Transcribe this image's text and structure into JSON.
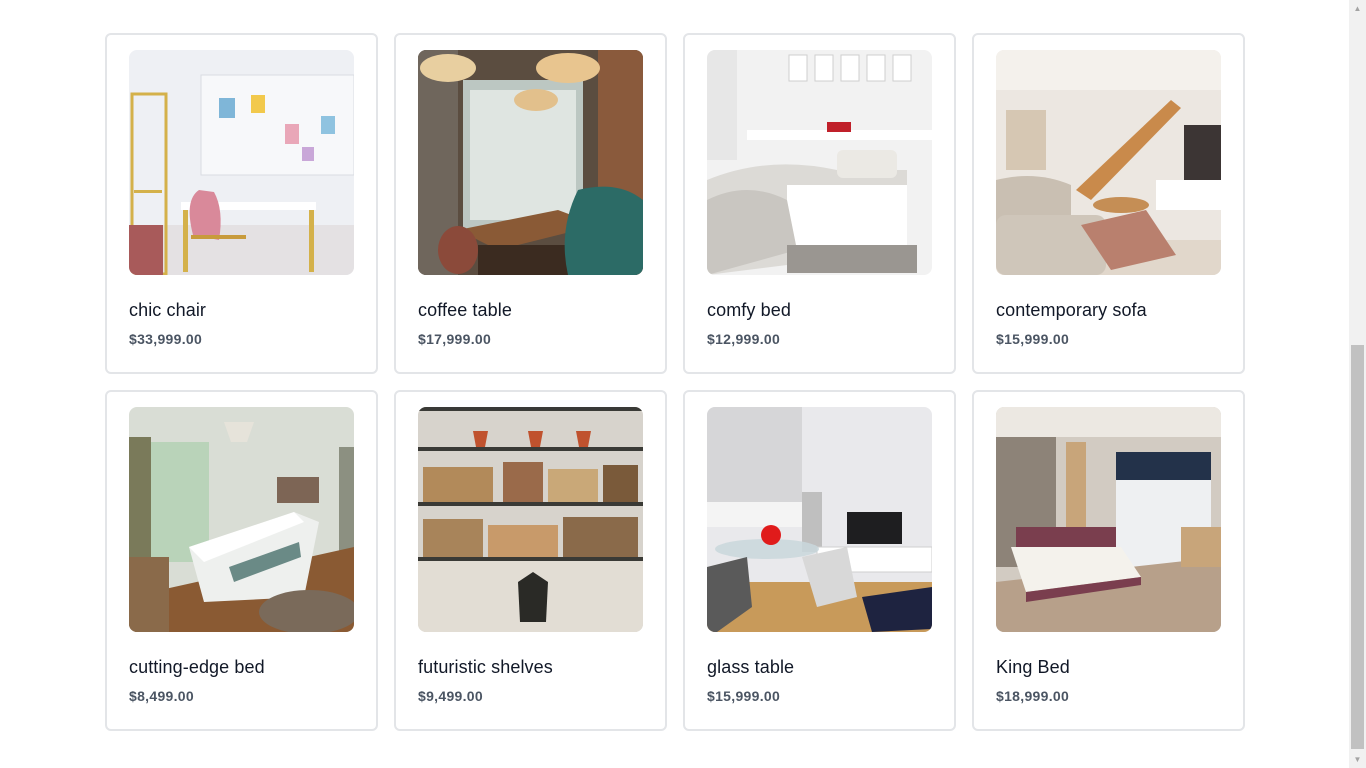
{
  "products": [
    {
      "name": "chic chair",
      "price": "$33,999.00",
      "image": "white-desk-room-photo"
    },
    {
      "name": "coffee table",
      "price": "$17,999.00",
      "image": "cafe-interior-photo"
    },
    {
      "name": "comfy bed",
      "price": "$12,999.00",
      "image": "white-bedroom-photo"
    },
    {
      "name": "contemporary sofa",
      "price": "$15,999.00",
      "image": "living-room-staircase-photo"
    },
    {
      "name": "cutting-edge bed",
      "price": "$8,499.00",
      "image": "bedroom-chandelier-photo"
    },
    {
      "name": "futuristic shelves",
      "price": "$9,499.00",
      "image": "bookshelves-photo"
    },
    {
      "name": "glass table",
      "price": "$15,999.00",
      "image": "dining-kitchen-photo"
    },
    {
      "name": "King Bed",
      "price": "$18,999.00",
      "image": "modern-bedroom-photo"
    }
  ],
  "colors": {
    "card_border": "#e3e5e8",
    "name_text": "#111827",
    "price_text": "#4b5563"
  },
  "scrollbar": {
    "up_icon": "scroll-up-arrow-icon",
    "down_icon": "scroll-down-arrow-icon"
  }
}
